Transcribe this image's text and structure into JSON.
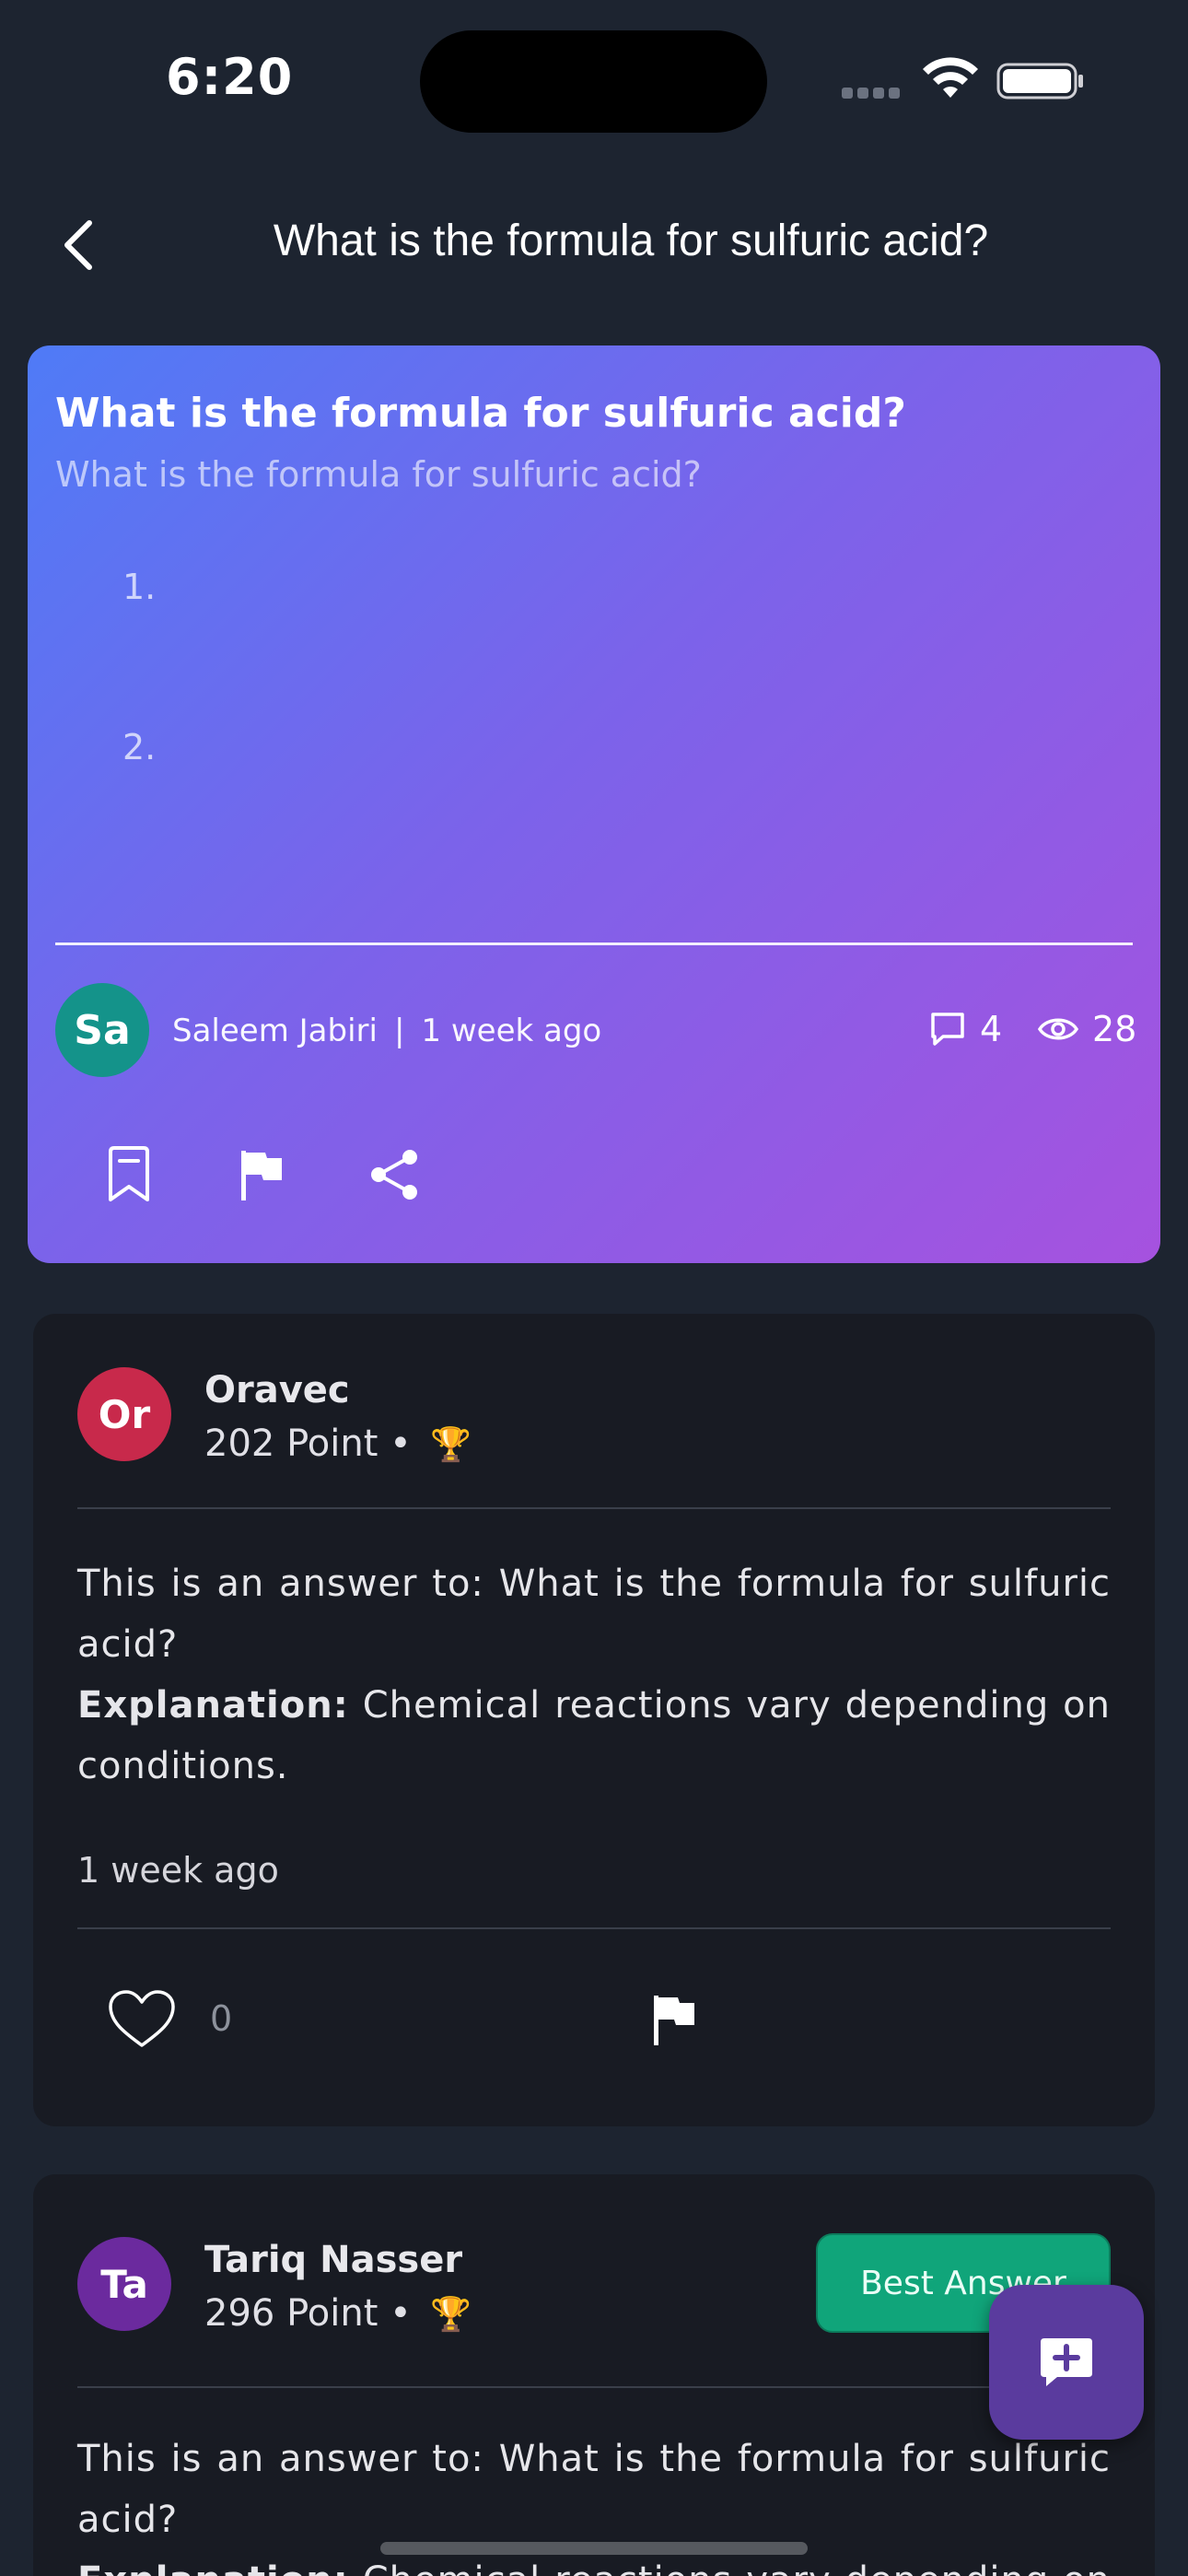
{
  "status_bar": {
    "time": "6:20"
  },
  "header": {
    "title": "What is the formula for sulfuric acid?"
  },
  "question": {
    "title": "What is the formula for sulfuric acid?",
    "body": "What is the formula for sulfuric acid?",
    "list_items": [
      "1.",
      "2."
    ],
    "author_initials": "Sa",
    "author_name": "Saleem Jabiri",
    "separator": "|",
    "time_ago": "1 week ago",
    "comment_count": "4",
    "view_count": "28",
    "avatar_color": "#14938a"
  },
  "answers": [
    {
      "initials": "Or",
      "name": "Oravec",
      "points": "202 Point •",
      "trophy": "🏆",
      "text": "This is an answer to: What is the formula for sulfuric acid?",
      "explanation_label": "Explanation:",
      "explanation": "Chemical reactions vary depending on conditions.",
      "time_ago": "1 week ago",
      "like_count": "0",
      "avatar_color": "#c8294b"
    },
    {
      "initials": "Ta",
      "name": "Tariq Nasser",
      "points": "296 Point •",
      "trophy": "🏆",
      "best_label": "Best Answer",
      "text": "This is an answer to: What is the formula for sulfuric acid?",
      "explanation_label": "Explanation:",
      "explanation": "Chemical reactions vary depending on conditions.",
      "avatar_color": "#6b2a9e"
    }
  ],
  "colors": {
    "background": "#1d2430",
    "card": "#181b23",
    "gradient_start": "#4f7bf6",
    "gradient_end": "#a652df",
    "best_answer": "#10a57a",
    "fab": "#5a3b9e"
  },
  "icons": [
    "back-chevron-icon",
    "comment-icon",
    "eye-icon",
    "bookmark-icon",
    "flag-icon",
    "share-icon",
    "heart-icon",
    "add-comment-icon",
    "wifi-icon",
    "battery-icon"
  ]
}
